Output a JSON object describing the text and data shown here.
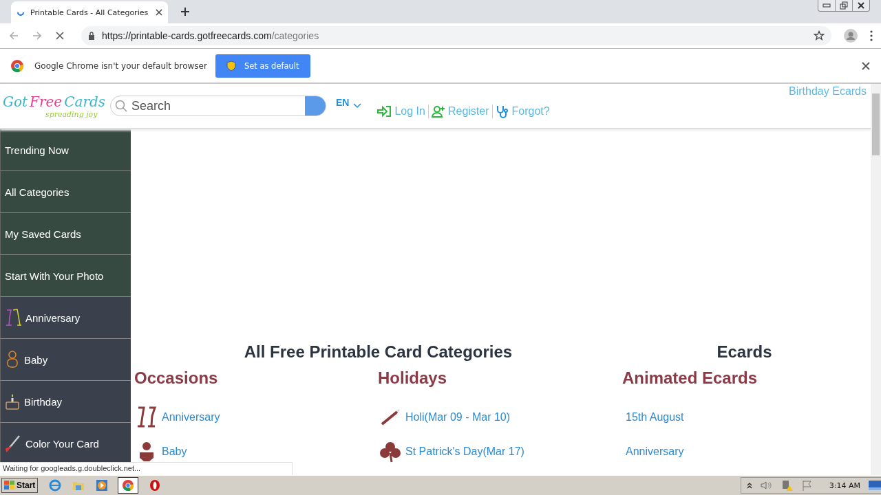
{
  "browser": {
    "tab": {
      "title": "Printable Cards - All Categories",
      "loading": true
    },
    "url": {
      "host": "https://printable-cards.gotfreecards.com",
      "path": "/categories"
    },
    "infobar": {
      "message": "Google Chrome isn't your default browser",
      "button": "Set as default"
    }
  },
  "site": {
    "logo": {
      "words": [
        "Got",
        "Free",
        "Cards"
      ],
      "tagline": "spreading joy"
    },
    "search": {
      "placeholder": "Search"
    },
    "language": "EN",
    "account_links": [
      "Log In",
      "Register",
      "Forgot?"
    ],
    "top_link": "Birthday Ecards",
    "sidebar": [
      {
        "label": "Trending Now",
        "kind": "feature"
      },
      {
        "label": "All Categories",
        "kind": "feature"
      },
      {
        "label": "My Saved Cards",
        "kind": "feature"
      },
      {
        "label": "Start With Your Photo",
        "kind": "feature"
      },
      {
        "label": "Anniversary",
        "kind": "category"
      },
      {
        "label": "Baby",
        "kind": "category"
      },
      {
        "label": "Birthday",
        "kind": "category"
      },
      {
        "label": "Color Your Card",
        "kind": "category"
      }
    ],
    "headings": [
      "All Free Printable Card Categories",
      "Ecards"
    ],
    "columns": [
      {
        "title": "Occasions",
        "items": [
          {
            "label": "Anniversary",
            "kind": "icon"
          },
          {
            "label": "Baby",
            "kind": "icon"
          }
        ]
      },
      {
        "title": "Holidays",
        "items": [
          {
            "label": "Holi(Mar 09 - Mar 10)",
            "kind": "icon"
          },
          {
            "label": "St Patrick's Day(Mar 17)",
            "kind": "icon"
          }
        ]
      },
      {
        "title": "Animated Ecards",
        "items": [
          {
            "label": "15th August",
            "kind": "plain"
          },
          {
            "label": "Anniversary",
            "kind": "plain"
          }
        ]
      }
    ]
  },
  "status": "Waiting for googleads.g.doubleclick.net...",
  "taskbar": {
    "start": "Start",
    "clock": "3:14 AM"
  }
}
